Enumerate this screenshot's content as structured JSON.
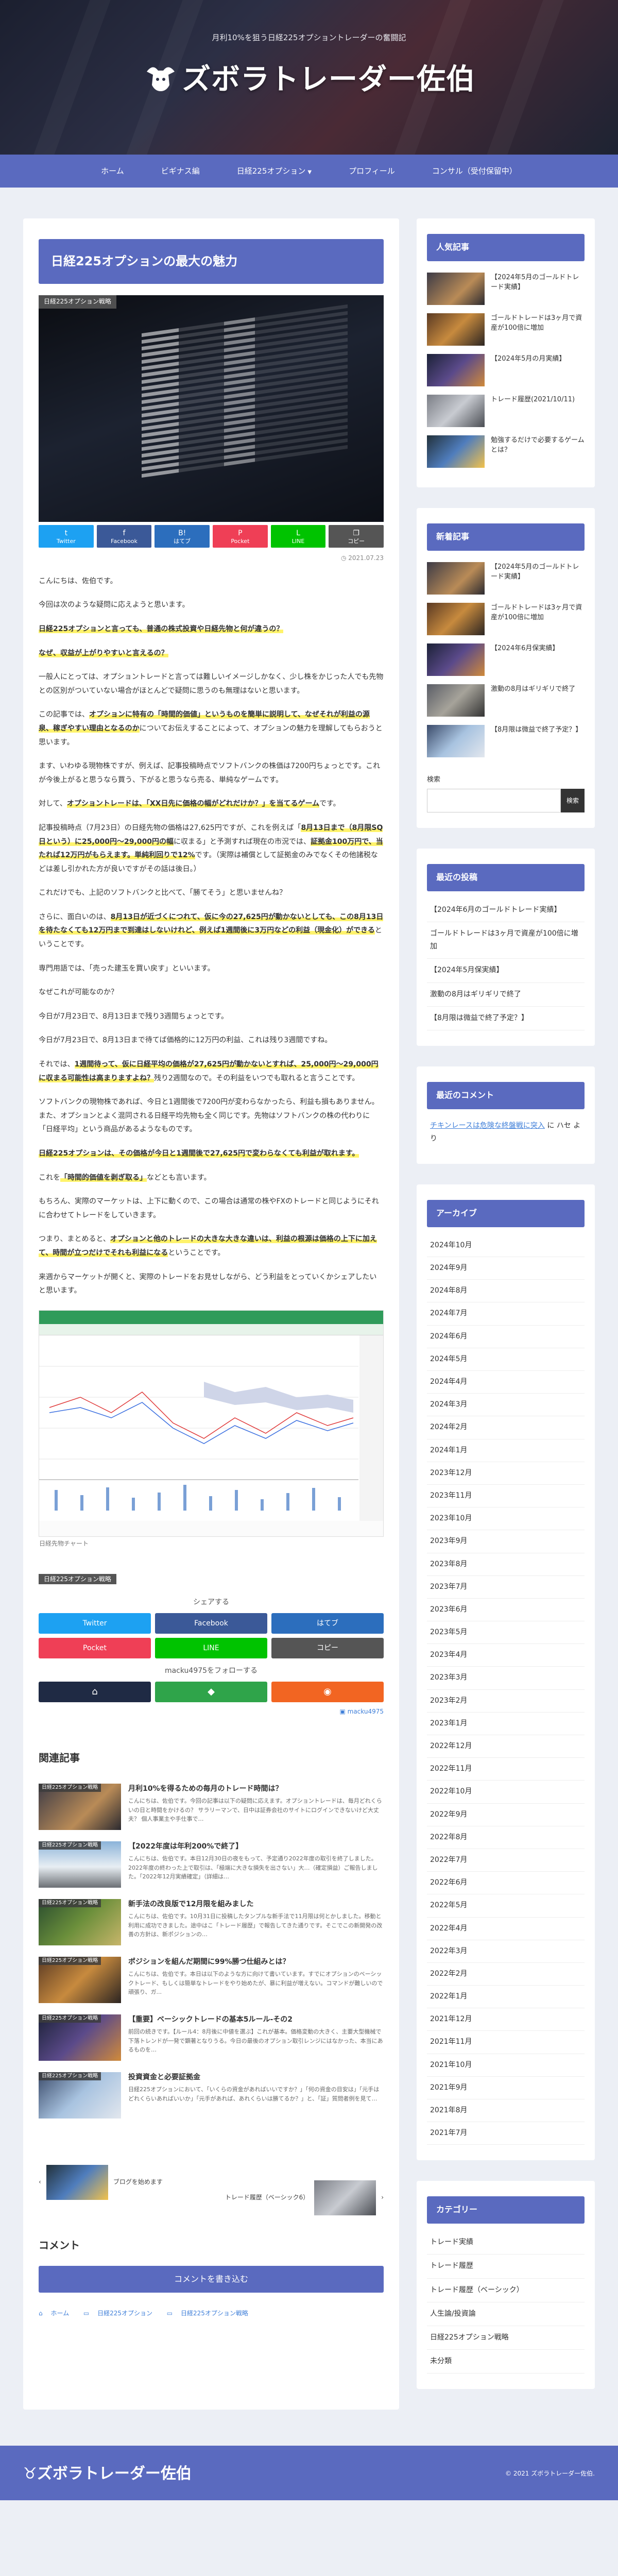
{
  "header": {
    "tagline": "月利10%を狙う日経225オプショントレーダーの奮闘記",
    "logo": "ズボラトレーダー佐伯"
  },
  "nav": [
    {
      "label": "ホーム",
      "caret": ""
    },
    {
      "label": "ビギナス編",
      "caret": ""
    },
    {
      "label": "日経225オプション",
      "caret": "▼"
    },
    {
      "label": "プロフィール",
      "caret": ""
    },
    {
      "label": "コンサル（受付保留中）",
      "caret": ""
    }
  ],
  "article": {
    "title": "日経225オプションの最大の魅力",
    "category": "日経225オプション戦略",
    "date": "2021.07.23",
    "share_top": [
      {
        "icon": "t",
        "label": "Twitter"
      },
      {
        "icon": "f",
        "label": "Facebook"
      },
      {
        "icon": "B!",
        "label": "はてブ"
      },
      {
        "icon": "P",
        "label": "Pocket"
      },
      {
        "icon": "L",
        "label": "LINE"
      },
      {
        "icon": "❐",
        "label": "コピー"
      }
    ],
    "p1": "こんにちは、佐伯です。",
    "p2": "今回は次のような疑問に応えようと思います。",
    "p3": "日経225オプションと言っても、普通の株式投資や日経先物と何が違うの？",
    "p4": "なぜ、収益が上がりやすいと言えるの？",
    "p5": "一般人にとっては、オプショントレードと言っては難しいイメージしかなく、少し株をかじった人でも先物との区別がついていない場合がほとんどで疑問に思うのも無理はないと思います。",
    "p6a": "この記事では、",
    "p6b": "オプションに特有の「時間的価値」というものを簡単に説明して、なぜそれが利益の源泉、稼ぎやすい理由となるのか",
    "p6c": "についてお伝えすることによって、オプションの魅力を理解してもらおうと思います。",
    "p7": "ます、いわゆる現物株ですが、例えば、記事投稿時点でソフトバンクの株価は7200円ちょっとです。これが今後上がると思うなら買う、下がると思うなら売る、単純なゲームです。",
    "p8a": "対して、",
    "p8b": "オプショントレードは、「XX日先に価格の幅がどれだけか？」を当てるゲーム",
    "p8c": "です。",
    "p9a": "記事投稿時点（7月23日）の日経先物の価格は27,625円ですが、これを例えば「",
    "p9b": "8月13日まで（8月限SQ日という）に25,000円〜29,000円の幅",
    "p9c": "に収まる」と予測すれば現在の市況では、",
    "p9d": "証拠金100万円で、当たれば12万円がもらえます。単純利回りで12%",
    "p9e": "です。（実際は補償として証拠金のみでなくその他諸税などは差し引かれた方が良いですがその話は後日。）",
    "p10": "これだけでも、上記のソフトバンクと比べて、「勝てそう」と思いませんね？",
    "p11a": "さらに、面白いのは、",
    "p11b": "8月13日が近づくにつれて、仮に今の27,625円が動かないとしても、この8月13日を待たなくても12万円まで到達はしないけれど、例えば1週間後に3万円などの利益（現金化）ができる",
    "p11c": "ということです。",
    "p12": "専門用語では、「売った建玉を買い戻す」といいます。",
    "p13": "なぜこれが可能なのか？",
    "p14": "今日が7月23日で、8月13日まで残り3週間ちょっとです。",
    "p15": "今日が7月23日で、8月13日まで待てば価格的に12万円の利益、これは残り3週間ですね。",
    "p16a": "それでは、",
    "p16b": "1週間待って、仮に日経平均の価格が27,625円が動かないとすれば、25,000円〜29,000円に収まる可能性は高まりますよね？",
    "p16c": "残り2週間なので。その利益をいつでも取れると言うことです。",
    "p17": "ソフトバンクの現物株であれば、今日と1週間後で7200円が変わらなかったら、利益も損もありません。また、オプションとよく混同される日経平均先物も全く同じです。先物はソフトバンクの株の代わりに「日経平均」という商品があるようなものです。",
    "p18": "日経225オプションは、その価格が今日と1週間後で27,625円で変わらなくても利益が取れます。",
    "p19a": "これを",
    "p19b": "「時間的価値を剥ぎ取る」",
    "p19c": "などとも言います。",
    "p20": "もちろん、実際のマーケットは、上下に動くので、この場合は通常の株やFXのトレードと同じようにそれに合わせてトレードをしていきます。",
    "p21a": "つまり、まとめると、",
    "p21b": "オプションと他のトレードの大きな大きな違いは、利益の根源は価格の上下に加えて、時間が立つだけでそれも利益になる",
    "p21c": "ということです。",
    "p22": "来週からマーケットが開くと、実際のトレードをお見せしながら、どう利益をとっていくかシェアしたいと思います。",
    "chart_caption": "日経先物チャート",
    "post_category": "日経225オプション戦略",
    "share_label": "シェアする",
    "share_bottom": [
      {
        "label": "Twitter",
        "cls": "c-tw"
      },
      {
        "label": "Facebook",
        "cls": "c-fb"
      },
      {
        "label": "はてブ",
        "cls": "c-hb"
      },
      {
        "label": "Pocket",
        "cls": "c-pk"
      },
      {
        "label": "LINE",
        "cls": "c-ln"
      },
      {
        "label": "コピー",
        "cls": "c-cp"
      }
    ],
    "follow_label": "macku4975をフォローする",
    "author_link": "macku4975"
  },
  "related": {
    "title": "関連記事",
    "items": [
      {
        "tag": "日経225オプション戦略",
        "title": "月利10%を得るための毎月のトレード時間は？",
        "snippet": "こんにちは、佐伯です。今回の記事は以下の疑問に応えます。オプショントレードは、毎月どれくらいの日と時間をかけるの？ サラリーマンで、日中は証券会社のサイトにログインできないけど大丈夫？ 個人事業主や手仕事で…"
      },
      {
        "tag": "日経225オプション戦略",
        "title": "【2022年度は年利200%で終了】",
        "snippet": "こんにちは、佐伯です。本日12月30日の夜をもって、予定通り2022年度の取引を終了しました。2022年度の終わった上で取引は、「極端に大きな損失を出さない」大…（確定損益）ご報告しました。「2022年12月実績確定」（詳細は…"
      },
      {
        "tag": "日経225オプション戦略",
        "title": "新手法の改良版で12月限を組みました",
        "snippet": "こんにちは、佐伯です。10月31日に投稿したタンプルな新手法で11月限は何とかしました。移動と利用に成功できました。途中はこ「トレード履歴」で報告してきた通りです。そこでこの新開発の改善の方針は、新ポジションの…"
      },
      {
        "tag": "日経225オプション戦略",
        "title": "ポジションを組んだ期間に99%勝つ仕組みとは？",
        "snippet": "こんにちは、佐伯です。本日は以下のような方に向けて書いています。すでにオプションのベーシックトレード、もしくは簡単なトレードをやり始めたが、暴に利益が増えない。コマンドが難しいので頑張り、ガ..."
      },
      {
        "tag": "日経225オプション戦略",
        "title": "【重要】ベーシックトレードの基本5ルール‐その2",
        "snippet": "前回の続きです。【ルール4：8月後に中値を選ぶ】これが基本。価格変動の大きく、主要大型機械で下落トレンドが一発で顕著となりうる。今日の最後のオプション取引レンジにはなかった、本当にあるものを…"
      },
      {
        "tag": "日経225オプション戦略",
        "title": "投資資金と必要証拠金",
        "snippet": "日経225オプションにおいて、「いくらの資金があればいいですか？」「何の資金の目安は」「元手はどれくらいあればいいか」「元手があれば、あれくらいは勝てるか？」と、「証」質問者例を見て…"
      }
    ]
  },
  "pager": {
    "prev": "ブログを始めます",
    "next": "トレード履歴（ベーシック6）"
  },
  "comments": {
    "title": "コメント",
    "button": "コメントを書き込む"
  },
  "breadcrumb": [
    "ホーム",
    "日経225オプション",
    "日経225オプション戦略"
  ],
  "sidebar": {
    "popular_title": "人気記事",
    "popular": [
      "【2024年5月のゴールドトレード実績】",
      "ゴールドトレードは3ヶ月で資産が100倍に増加",
      "【2024年5月の月実績】",
      "トレード履歴(2021/10/11)",
      "勉強するだけで必要するゲームとは？"
    ],
    "new_title": "新着記事",
    "new": [
      "【2024年5月のゴールドトレード実績】",
      "ゴールドトレードは3ヶ月で資産が100倍に増加",
      "【2024年6月保実績】",
      "激動の8月はギリギリで終了",
      "【8月限は微益で終了予定？】"
    ],
    "search_label": "検索",
    "search_placeholder": "",
    "search_button": "検索",
    "recent_title": "最近の投稿",
    "recent": [
      "【2024年6月のゴールドトレード実績】",
      "ゴールドトレードは3ヶ月で資産が100倍に増加",
      "【2024年5月保実績】",
      "激動の8月はギリギリで終了",
      "【8月限は微益で終了予定？】"
    ],
    "comments_title": "最近のコメント",
    "comment_link": "チキンレースは危険な終盤戦に突入",
    "comment_suffix": " に ハセ より",
    "archive_title": "アーカイブ",
    "archive": [
      "2024年10月",
      "2024年9月",
      "2024年8月",
      "2024年7月",
      "2024年6月",
      "2024年5月",
      "2024年4月",
      "2024年3月",
      "2024年2月",
      "2024年1月",
      "2023年12月",
      "2023年11月",
      "2023年10月",
      "2023年9月",
      "2023年8月",
      "2023年7月",
      "2023年6月",
      "2023年5月",
      "2023年4月",
      "2023年3月",
      "2023年2月",
      "2023年1月",
      "2022年12月",
      "2022年11月",
      "2022年10月",
      "2022年9月",
      "2022年8月",
      "2022年7月",
      "2022年6月",
      "2022年5月",
      "2022年4月",
      "2022年3月",
      "2022年2月",
      "2022年1月",
      "2021年12月",
      "2021年11月",
      "2021年10月",
      "2021年9月",
      "2021年8月",
      "2021年7月"
    ],
    "category_title": "カテゴリー",
    "categories": [
      "トレード実績",
      "トレード履歴",
      "トレード履歴（ベーシック）",
      "人生論/投資論",
      "日経225オプション戦略",
      "未分類"
    ]
  },
  "footer": {
    "logo": "ズボラトレーダー佐伯",
    "copyright": "© 2021 ズボラトレーダー佐伯."
  }
}
